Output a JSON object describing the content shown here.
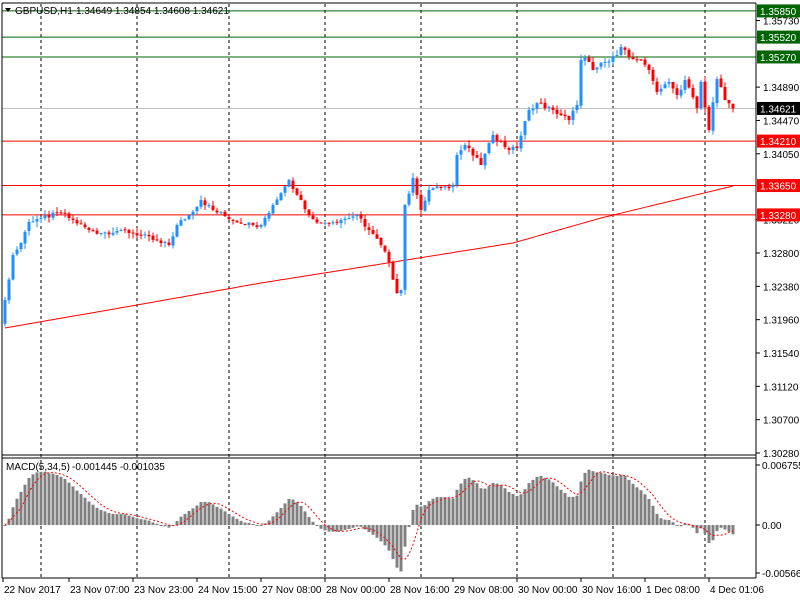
{
  "header": {
    "symbol": "GBPUSD,H1",
    "ohlc": "1.34649 1.34854 1.34608 1.34621"
  },
  "macd_label": {
    "name": "MACD(5,34,5)",
    "values": "-0.001445 -0.001035"
  },
  "colors": {
    "bull": "#1e90ff",
    "bear": "#ff0000",
    "ma": "#ff0000",
    "support": "#ff0000",
    "resistance": "#006400",
    "current": "#c0c0c0",
    "histogram": "#808080",
    "signal": "#ff0000"
  },
  "chart_data": {
    "type": "candlestick",
    "title": "GBPUSD,H1",
    "price_axis": {
      "range": [
        1.3028,
        1.3599
      ],
      "ticks": [
        "1.35730",
        "1.34890",
        "1.34470",
        "1.34050",
        "1.33220",
        "1.32800",
        "1.32380",
        "1.31960",
        "1.31540",
        "1.31120",
        "1.30700",
        "1.30280"
      ]
    },
    "candle_count": 183,
    "close_path": [
      [
        0,
        1.32208
      ],
      [
        2,
        1.32775
      ],
      [
        4,
        1.32926
      ],
      [
        6,
        1.33191
      ],
      [
        9,
        1.33241
      ],
      [
        14,
        1.33304
      ],
      [
        17,
        1.33216
      ],
      [
        21,
        1.3309
      ],
      [
        24,
        1.33052
      ],
      [
        29,
        1.3309
      ],
      [
        34,
        1.33027
      ],
      [
        39,
        1.32926
      ],
      [
        41,
        1.32901
      ],
      [
        43,
        1.33153
      ],
      [
        46,
        1.33279
      ],
      [
        49,
        1.33468
      ],
      [
        52,
        1.33342
      ],
      [
        57,
        1.33216
      ],
      [
        62,
        1.33153
      ],
      [
        64,
        1.33153
      ],
      [
        67,
        1.33405
      ],
      [
        71,
        1.3372
      ],
      [
        74,
        1.33468
      ],
      [
        76,
        1.33279
      ],
      [
        79,
        1.33178
      ],
      [
        84,
        1.33216
      ],
      [
        88,
        1.33279
      ],
      [
        91,
        1.3309
      ],
      [
        94,
        1.32901
      ],
      [
        96,
        1.32687
      ],
      [
        98,
        1.32296
      ],
      [
        99,
        1.32334
      ],
      [
        100,
        1.33405
      ],
      [
        102,
        1.33745
      ],
      [
        103,
        1.33531
      ],
      [
        104,
        1.33342
      ],
      [
        106,
        1.33594
      ],
      [
        109,
        1.33619
      ],
      [
        112,
        1.33657
      ],
      [
        113,
        1.34035
      ],
      [
        115,
        1.34161
      ],
      [
        119,
        1.33909
      ],
      [
        122,
        1.34287
      ],
      [
        126,
        1.34098
      ],
      [
        128,
        1.34123
      ],
      [
        131,
        1.34602
      ],
      [
        133,
        1.3469
      ],
      [
        137,
        1.34602
      ],
      [
        141,
        1.34476
      ],
      [
        143,
        1.34665
      ],
      [
        144,
        1.35232
      ],
      [
        145,
        1.35257
      ],
      [
        147,
        1.35106
      ],
      [
        150,
        1.35207
      ],
      [
        153,
        1.35295
      ],
      [
        154,
        1.35396
      ],
      [
        156,
        1.3527
      ],
      [
        159,
        1.35232
      ],
      [
        161,
        1.35106
      ],
      [
        163,
        1.34829
      ],
      [
        166,
        1.34955
      ],
      [
        168,
        1.34791
      ],
      [
        170,
        1.3498
      ],
      [
        173,
        1.34627
      ],
      [
        174,
        1.34955
      ],
      [
        176,
        1.3435
      ],
      [
        178,
        1.34991
      ],
      [
        180,
        1.34728
      ],
      [
        182,
        1.34621
      ]
    ],
    "moving_average_path": [
      [
        0,
        1.31855
      ],
      [
        33,
        1.32145
      ],
      [
        64,
        1.32422
      ],
      [
        94,
        1.32661
      ],
      [
        127,
        1.32926
      ],
      [
        149,
        1.33241
      ],
      [
        182,
        1.33644
      ]
    ],
    "levels": [
      {
        "label": "1.35850",
        "value": 1.3585,
        "kind": "resistance"
      },
      {
        "label": "1.35520",
        "value": 1.3552,
        "kind": "resistance"
      },
      {
        "label": "1.35270",
        "value": 1.3527,
        "kind": "resistance"
      },
      {
        "label": "1.34621",
        "value": 1.34621,
        "kind": "current"
      },
      {
        "label": "1.34210",
        "value": 1.3421,
        "kind": "support"
      },
      {
        "label": "1.33650",
        "value": 1.3365,
        "kind": "support"
      },
      {
        "label": "1.33280",
        "value": 1.3328,
        "kind": "support"
      }
    ],
    "macd": {
      "fast": 5,
      "slow": 34,
      "signal": 5,
      "range": [
        -0.005663,
        0.006755
      ],
      "ticks": [
        "0.006755",
        "0.00",
        "-0.005663"
      ]
    },
    "time_labels": [
      {
        "label": "22 Nov 2017",
        "index": 0
      },
      {
        "label": "23 Nov 07:00",
        "index": 16
      },
      {
        "label": "23 Nov 23:00",
        "index": 32
      },
      {
        "label": "24 Nov 15:00",
        "index": 48
      },
      {
        "label": "27 Nov 08:00",
        "index": 64
      },
      {
        "label": "28 Nov 00:00",
        "index": 80
      },
      {
        "label": "28 Nov 16:00",
        "index": 96
      },
      {
        "label": "29 Nov 08:00",
        "index": 112
      },
      {
        "label": "30 Nov 00:00",
        "index": 128
      },
      {
        "label": "30 Nov 16:00",
        "index": 144
      },
      {
        "label": "1 Dec 08:00",
        "index": 160
      },
      {
        "label": "4 Dec 01:06",
        "index": 176
      }
    ],
    "day_separators": [
      9,
      33,
      56,
      80,
      104,
      128,
      152,
      175
    ]
  }
}
